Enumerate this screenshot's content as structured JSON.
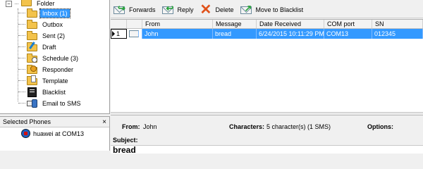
{
  "tree": {
    "root_label": "Folder",
    "items": [
      {
        "label": "Inbox (1)",
        "icon": "inbox-icon",
        "selected": true
      },
      {
        "label": "Outbox",
        "icon": "outbox-icon"
      },
      {
        "label": "Sent (2)",
        "icon": "sent-icon"
      },
      {
        "label": "Draft",
        "icon": "draft-icon"
      },
      {
        "label": "Schedule (3)",
        "icon": "schedule-icon"
      },
      {
        "label": "Responder",
        "icon": "responder-icon"
      },
      {
        "label": "Template",
        "icon": "template-icon"
      },
      {
        "label": "Blacklist",
        "icon": "blacklist-icon"
      },
      {
        "label": "Email to SMS",
        "icon": "email-to-sms-icon"
      }
    ]
  },
  "phones": {
    "header": "Selected Phones",
    "close_glyph": "×",
    "items": [
      {
        "label": "huawei at COM13"
      }
    ]
  },
  "toolbar": {
    "forwards": "Forwards",
    "reply": "Reply",
    "delete": "Delete",
    "blacklist": "Move to Blacklist"
  },
  "grid": {
    "columns": [
      "",
      "",
      "From",
      "Message",
      "Date Received",
      "COM port",
      "SN"
    ],
    "rows": [
      {
        "index": "1",
        "from": "John",
        "message": "bread",
        "date": "6/24/2015 10:11:29 PM",
        "com_port": "COM13",
        "sn": "012345"
      }
    ]
  },
  "detail": {
    "from_label": "From:",
    "from_value": "John",
    "characters_label": "Characters:",
    "characters_value": "5 character(s) (1 SMS)",
    "options_label": "Options:",
    "subject_label": "Subject:",
    "body": "bread"
  },
  "colors": {
    "selection": "#3399ff",
    "folder": "#f3c34b"
  }
}
